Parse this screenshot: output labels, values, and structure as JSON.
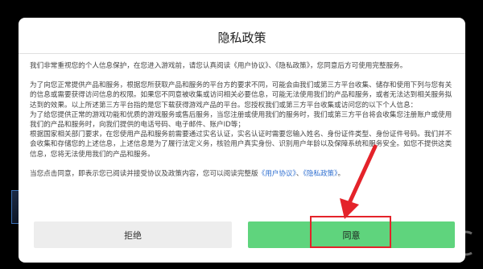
{
  "dialog": {
    "title": "隐私政策",
    "paragraph_intro": "我们非常重视您的个人信息保护，在您进入游戏前，请您认真阅读《用户协议》、《隐私政策》，您同意后方可使用完整服务。",
    "paragraph_body_1": "为了向您正常提供产品和服务，根据您所获取产品和服务的平台方的要求不同，可能会由我们或第三方平台收集、储存和使用下列与您有关的信息或需要获得访问信息的权限。如果您不同意被收集或访问相关必要信息，可能无法使用我们的产品和服务，或者无法达到相关服务拟达到的效果。以上所述第三方平台指的是您下载获得游戏产品的平台。您授权我们或第三方平台收集或访问您的以下个人信息：",
    "paragraph_body_2": "为了给您提供正常的游戏功能和优质的游戏服务或售后服务，当您注册或使用我们的服务时，我们或第三方平台将会收集您注册账户或使用我们的产品和服务时，向我们提供的电话号码、电子邮件、账户ID等；",
    "paragraph_body_3": "根据国家相关部门要求，在您使用产品和服务前需要通过实名认证，实名认证时需要您输入姓名、身份证件类型、身份证件号码。我们并不会收集和存储您的上述信息，上述信息是为了履行法定义务，核验用户真实身份、识别用户年龄以及保障系统和服务安全。如您不提供这类信息，您将无法使用我们的产品和服务。",
    "consent_prefix": "当您点击同意，即表示您已阅读并接受协议及政策内容，您可以阅读完整版",
    "link_user_agreement": "《用户协议》",
    "consent_separator": "、",
    "link_privacy_policy": "《隐私政策》",
    "consent_suffix": "。"
  },
  "buttons": {
    "refuse_label": "拒绝",
    "agree_label": "同意"
  },
  "colors": {
    "agree_bg": "#5fd47d",
    "refuse_bg": "#ededed",
    "link": "#2f6fd0",
    "annotation_red": "#e4232a"
  }
}
